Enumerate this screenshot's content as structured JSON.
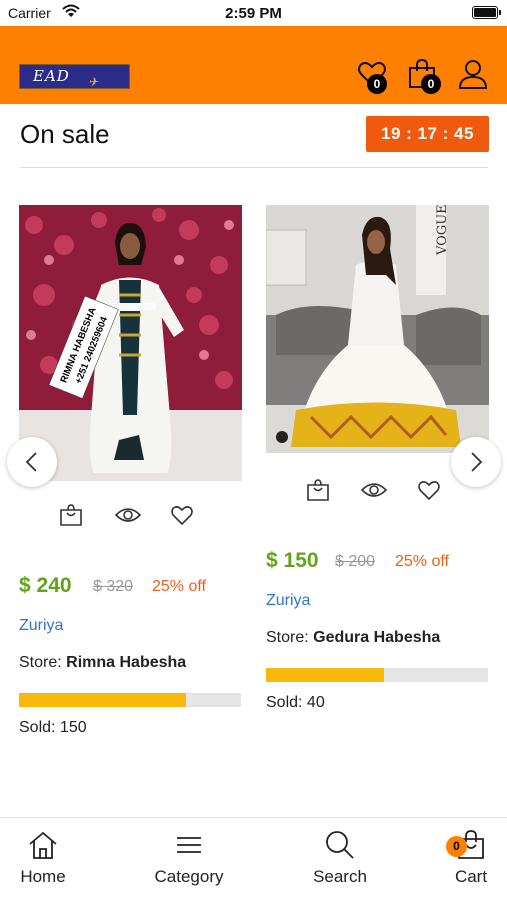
{
  "status_bar": {
    "carrier": "Carrier",
    "time": "2:59 PM"
  },
  "header": {
    "logo_text": "EAD",
    "wishlist_count": "0",
    "bag_count": "0",
    "brand_color": "#ff7f00"
  },
  "section": {
    "title": "On sale",
    "countdown": "19 : 17 : 45"
  },
  "products": [
    {
      "price": "$ 240",
      "old_price": "$ 320",
      "discount": "25% off",
      "category": "Zuriya",
      "store_label": "Store:",
      "store_name": "Rimna Habesha",
      "sold_progress": 0.75,
      "sold_label": "Sold: 150",
      "image_overlay_lines": [
        "RIMNA HABESHA",
        "+251 240259604"
      ]
    },
    {
      "price": "$ 150",
      "old_price": "$ 200",
      "discount": "25% off",
      "category": "Zuriya",
      "store_label": "Store:",
      "store_name": "Gedura Habesha",
      "sold_progress": 0.53,
      "sold_label": "Sold: 40",
      "image_overlay_lines": [
        "VOGUE"
      ]
    }
  ],
  "tab_bar": {
    "items": [
      {
        "label": "Home",
        "icon": "home-icon"
      },
      {
        "label": "Category",
        "icon": "menu-icon"
      },
      {
        "label": "Search",
        "icon": "search-icon"
      },
      {
        "label": "Cart",
        "icon": "cart-icon"
      }
    ],
    "cart_count": "0"
  },
  "colors": {
    "accent": "#ff7f00",
    "countdown_bg": "#f05a0e",
    "price_green": "#63a21b",
    "discount_orange": "#e8601a",
    "link_blue": "#2d78c8",
    "progress_fill": "#fbb80c"
  }
}
